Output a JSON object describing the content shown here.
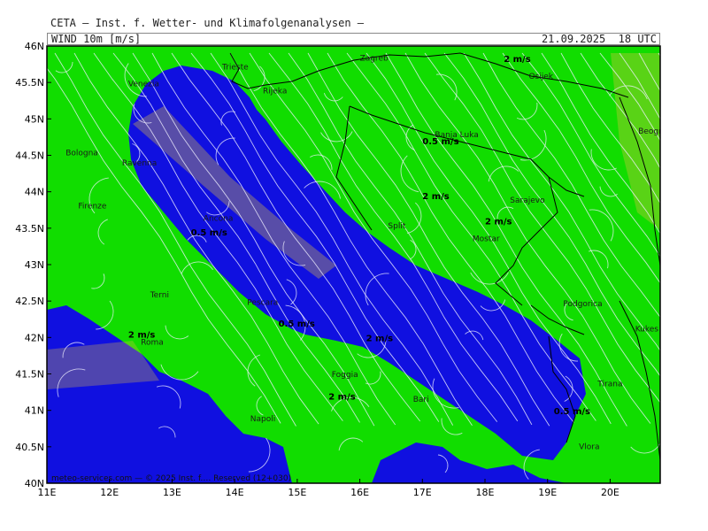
{
  "header": {
    "title": "CETA — Inst. f. Wetter- und Klimafolgenanalysen —",
    "variable": "WIND 10m [m/s]",
    "valid_time": "21.09.2025  18 UTC"
  },
  "map": {
    "lon_range": [
      11,
      20.8
    ],
    "lat_range": [
      40,
      46
    ],
    "x_ticks": [
      "11E",
      "12E",
      "13E",
      "14E",
      "15E",
      "16E",
      "17E",
      "18E",
      "19E",
      "20E"
    ],
    "x_tick_values": [
      11,
      12,
      13,
      14,
      15,
      16,
      17,
      18,
      19,
      20
    ],
    "y_ticks": [
      "46N",
      "45.5N",
      "45N",
      "44.5N",
      "44N",
      "43.5N",
      "43N",
      "42.5N",
      "42N",
      "41.5N",
      "41N",
      "40.5N",
      "40N"
    ],
    "y_tick_values": [
      46,
      45.5,
      45,
      44.5,
      44,
      43.5,
      43,
      42.5,
      42,
      41.5,
      41,
      40.5,
      40
    ],
    "colors": {
      "land_wind": "#11dd00",
      "sea_wind": "#1010e0",
      "strong_wind": "#e0c040",
      "streamline": "#f0f0ff",
      "border": "#000000"
    },
    "cities": [
      {
        "name": "Zagreb",
        "lon": 16.0,
        "lat": 45.8
      },
      {
        "name": "Osijek",
        "lon": 18.7,
        "lat": 45.55
      },
      {
        "name": "Venezia",
        "lon": 12.3,
        "lat": 45.45
      },
      {
        "name": "Trieste",
        "lon": 13.8,
        "lat": 45.68
      },
      {
        "name": "Rijeka",
        "lon": 14.45,
        "lat": 45.35
      },
      {
        "name": "Bologna",
        "lon": 11.3,
        "lat": 44.5
      },
      {
        "name": "Ravenna",
        "lon": 12.2,
        "lat": 44.36
      },
      {
        "name": "Banja Luka",
        "lon": 17.2,
        "lat": 44.75
      },
      {
        "name": "Beograd",
        "lon": 20.45,
        "lat": 44.8
      },
      {
        "name": "Firenze",
        "lon": 11.5,
        "lat": 43.77
      },
      {
        "name": "Ancona",
        "lon": 13.5,
        "lat": 43.6
      },
      {
        "name": "Split",
        "lon": 16.45,
        "lat": 43.5
      },
      {
        "name": "Sarajevo",
        "lon": 18.4,
        "lat": 43.85
      },
      {
        "name": "Mostar",
        "lon": 17.8,
        "lat": 43.32
      },
      {
        "name": "Terni",
        "lon": 12.65,
        "lat": 42.55
      },
      {
        "name": "Pescara",
        "lon": 14.2,
        "lat": 42.45
      },
      {
        "name": "Podgorica",
        "lon": 19.25,
        "lat": 42.43
      },
      {
        "name": "Kukes",
        "lon": 20.4,
        "lat": 42.08
      },
      {
        "name": "Roma",
        "lon": 12.5,
        "lat": 41.9
      },
      {
        "name": "Foggia",
        "lon": 15.55,
        "lat": 41.46
      },
      {
        "name": "Tirana",
        "lon": 19.8,
        "lat": 41.33
      },
      {
        "name": "Bari",
        "lon": 16.85,
        "lat": 41.12
      },
      {
        "name": "Napoli",
        "lon": 14.25,
        "lat": 40.85
      },
      {
        "name": "Vlora",
        "lon": 19.5,
        "lat": 40.47
      }
    ],
    "contour_labels": [
      {
        "text": "2 m/s",
        "lon": 18.3,
        "lat": 45.78
      },
      {
        "text": "0.5 m/s",
        "lon": 17.0,
        "lat": 44.65
      },
      {
        "text": "2 m/s",
        "lon": 17.0,
        "lat": 43.9
      },
      {
        "text": "2 m/s",
        "lon": 18.0,
        "lat": 43.55
      },
      {
        "text": "0.5 m/s",
        "lon": 13.3,
        "lat": 43.4
      },
      {
        "text": "2 m/s",
        "lon": 12.3,
        "lat": 42.0
      },
      {
        "text": "0.5 m/s",
        "lon": 14.7,
        "lat": 42.15
      },
      {
        "text": "2 m/s",
        "lon": 16.1,
        "lat": 41.95
      },
      {
        "text": "2 m/s",
        "lon": 15.5,
        "lat": 41.15
      },
      {
        "text": "0.5 m/s",
        "lon": 19.1,
        "lat": 40.95
      }
    ],
    "copyright": "meteo-services.com — © 2025 Inst. f.… Reserved (12+030)"
  }
}
